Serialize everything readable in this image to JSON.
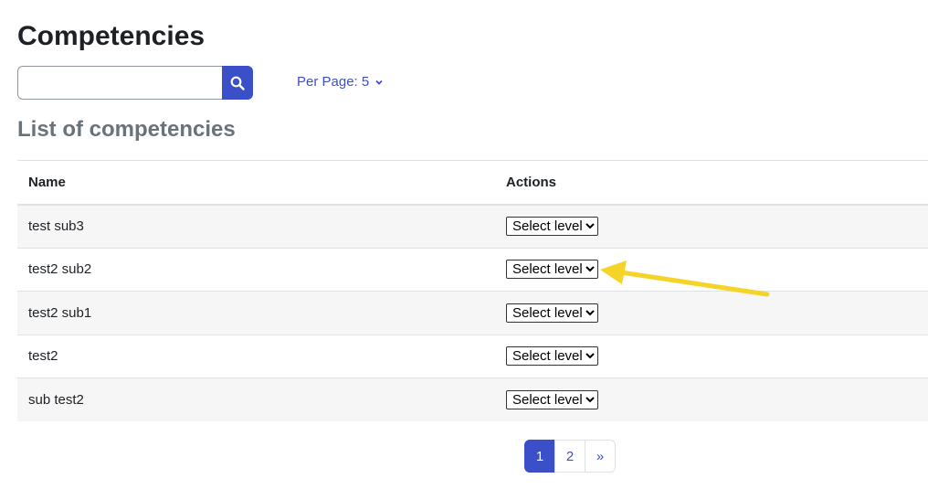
{
  "page": {
    "title": "Competencies"
  },
  "search": {
    "placeholder": "",
    "value": ""
  },
  "per_page": {
    "label": "Per Page: 5"
  },
  "section": {
    "title": "List of competencies"
  },
  "table": {
    "headers": [
      "Name",
      "Actions"
    ],
    "rows": [
      {
        "name": "test sub3",
        "action": "Select level"
      },
      {
        "name": "test2 sub2",
        "action": "Select level"
      },
      {
        "name": "test2 sub1",
        "action": "Select level"
      },
      {
        "name": "test2",
        "action": "Select level"
      },
      {
        "name": "sub test2",
        "action": "Select level"
      }
    ]
  },
  "pagination": {
    "pages": [
      "1",
      "2"
    ],
    "next": "»",
    "current": "1"
  },
  "colors": {
    "accent": "#3b4fc9",
    "annotation": "#f5d327",
    "row_stripe": "#f6f6f6"
  },
  "icons": {
    "search": "search-icon",
    "per_page": "chevron-down-icon",
    "annotation": "arrow-annotation"
  }
}
